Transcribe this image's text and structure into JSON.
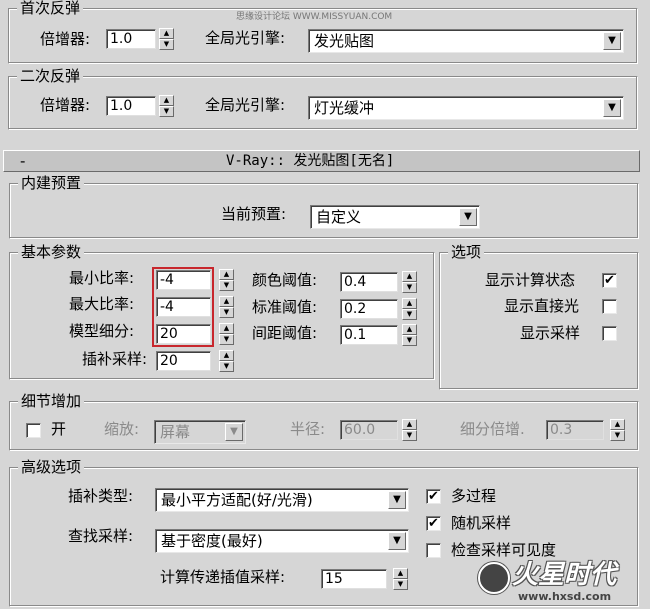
{
  "watermark": "思缘设计论坛 WWW.MISSYUAN.COM",
  "primary_bounce": {
    "title": "首次反弹",
    "multiplier_label": "倍增器:",
    "multiplier_value": "1.0",
    "engine_label": "全局光引擎:",
    "engine_value": "发光贴图"
  },
  "secondary_bounce": {
    "title": "二次反弹",
    "multiplier_label": "倍增器:",
    "multiplier_value": "1.0",
    "engine_label": "全局光引擎:",
    "engine_value": "灯光缓冲"
  },
  "rollout": {
    "collapse_symbol": "-",
    "title": "V-Ray:: 发光贴图[无名]"
  },
  "builtin_presets": {
    "title": "内建预置",
    "current_label": "当前预置:",
    "current_value": "自定义"
  },
  "basic_params": {
    "title": "基本参数",
    "min_rate_label": "最小比率:",
    "min_rate_value": "-4",
    "max_rate_label": "最大比率:",
    "max_rate_value": "-4",
    "hsph_label": "模型细分:",
    "hsph_value": "20",
    "interp_label": "插补采样:",
    "interp_value": "20",
    "clr_thresh_label": "颜色阈值:",
    "clr_thresh_value": "0.4",
    "nrm_thresh_label": "标准阈值:",
    "nrm_thresh_value": "0.2",
    "dist_thresh_label": "间距阈值:",
    "dist_thresh_value": "0.1"
  },
  "options": {
    "title": "选项",
    "show_calc_label": "显示计算状态",
    "show_calc_checked": true,
    "show_direct_label": "显示直接光",
    "show_direct_checked": false,
    "show_samples_label": "显示采样",
    "show_samples_checked": false
  },
  "detail": {
    "title": "细节增加",
    "on_label": "开",
    "on_checked": false,
    "scale_label": "缩放:",
    "scale_value": "屏幕",
    "radius_label": "半径:",
    "radius_value": "60.0",
    "subdivs_label": "细分倍增.",
    "subdivs_value": "0.3"
  },
  "advanced": {
    "title": "高级选项",
    "interp_type_label": "插补类型:",
    "interp_type_value": "最小平方适配(好/光滑)",
    "lookup_label": "查找采样:",
    "lookup_value": "基于密度(最好)",
    "calc_pass_label": "计算传递插值采样:",
    "calc_pass_value": "15",
    "multipass_label": "多过程",
    "multipass_checked": true,
    "randomize_label": "随机采样",
    "randomize_checked": true,
    "check_vis_label": "检查采样可见度",
    "check_vis_checked": false
  },
  "logo": {
    "text": "火星时代",
    "url": "www.hxsd.com"
  },
  "colors": {
    "background": "#d6d6d6",
    "highlight": "#c8272d"
  }
}
